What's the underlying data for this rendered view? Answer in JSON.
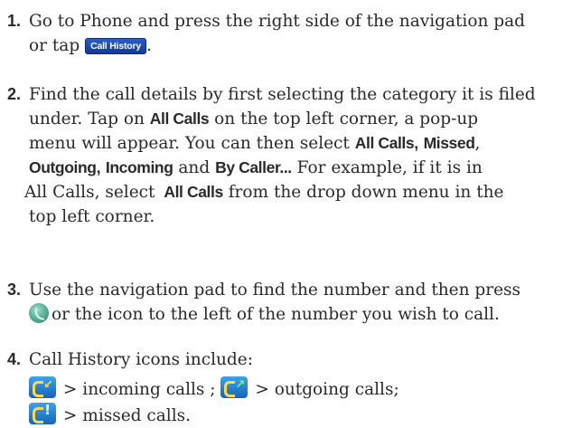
{
  "steps": [
    {
      "num": "1.",
      "line1": "Go to Phone and press the right side of the navigation pad",
      "line2_pre": "or tap",
      "button_label": "Call History",
      "line2_post": "."
    },
    {
      "num": "2.",
      "l1": "Find the call details by first selecting the category it is filed",
      "l2_pre": "under. Tap on",
      "l2_ui": "All Calls",
      "l2_post": "on the top left corner, a pop-up",
      "l3_pre": "menu  will appear. You can then select",
      "l3_ui1": "All Calls",
      "l3_sep": ",",
      "l3_ui2": "Missed",
      "l3_post": ",",
      "l4_ui1": "Outgoing",
      "l4_sep1": ",",
      "l4_ui2": "Incoming",
      "l4_mid": "and",
      "l4_ui3": "By Caller...",
      "l4_post": "For example, if it is in",
      "l5_pre": "All Calls, select",
      "l5_ui": "All Calls",
      "l5_post": "from the drop down menu in the",
      "l6": "top left corner."
    },
    {
      "num": "3.",
      "l1": "Use the navigation pad to find the number and then press",
      "l2": "or the icon to the left of the number you wish to call."
    },
    {
      "num": "4.",
      "l1": "Call History icons include:",
      "incoming": "> incoming calls ;",
      "outgoing": "> outgoing calls;",
      "missed": "> missed calls."
    }
  ],
  "icons": {
    "call_history_button": "call-history-button",
    "talk_key": "green-phone-icon",
    "incoming": "incoming-call-icon",
    "outgoing": "outgoing-call-icon",
    "missed": "missed-call-icon"
  }
}
